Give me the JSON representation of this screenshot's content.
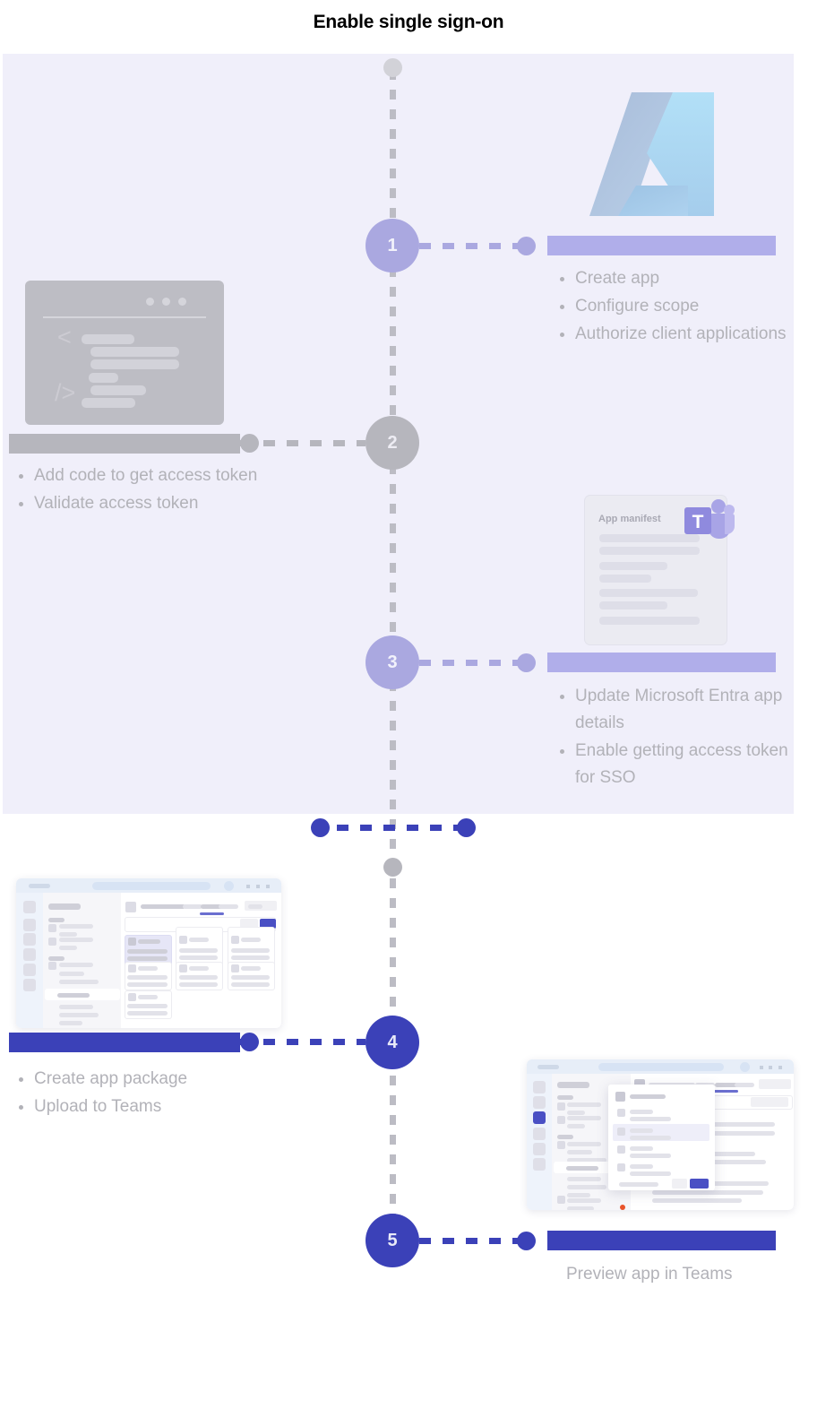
{
  "diagram": {
    "title": "Enable single sign-on",
    "type": "vertical-timeline-flow",
    "steps": [
      {
        "number": "1",
        "state": "highlighted",
        "side": "right",
        "accent": "#aaa8e0",
        "illustration": "azure-entra-logo",
        "items": [
          "Create app",
          "Configure scope",
          "Authorize client applications"
        ]
      },
      {
        "number": "2",
        "state": "dimmed",
        "side": "left",
        "accent": "#b6b6bd",
        "illustration": "code-editor-window",
        "items": [
          "Add code to get access token",
          "Validate access token"
        ]
      },
      {
        "number": "3",
        "state": "highlighted",
        "side": "right",
        "accent": "#aaa8e0",
        "illustration": "app-manifest-card",
        "illustration_label": "App manifest",
        "items": [
          "Update Microsoft Entra app details",
          "Enable getting access token for SSO"
        ]
      },
      {
        "number": "4",
        "state": "active",
        "side": "left",
        "accent": "#3b41b8",
        "illustration": "teams-app-window",
        "items": [
          "Create app package",
          "Upload to Teams"
        ]
      },
      {
        "number": "5",
        "state": "active",
        "side": "right",
        "accent": "#3b41b8",
        "illustration": "teams-app-dialog-window",
        "caption": "Preview app in Teams",
        "items": []
      }
    ],
    "colors": {
      "panel_background": "#f0effa",
      "page_background": "#ffffff",
      "title_text": "#000000",
      "body_text": "#b2b2b8",
      "accent_light": "#aaa8e0",
      "accent_gray": "#b6b6bd",
      "accent_dark": "#3b41b8",
      "bar_light": "#b0aeea",
      "bar_gray": "#b6b6bd",
      "bar_dark": "#3b41b8",
      "timeline_dash": "#bcbcc4",
      "azure_logo_blue": "#a9cdeb",
      "teams_badge_purple": "#a8a4e6"
    }
  }
}
